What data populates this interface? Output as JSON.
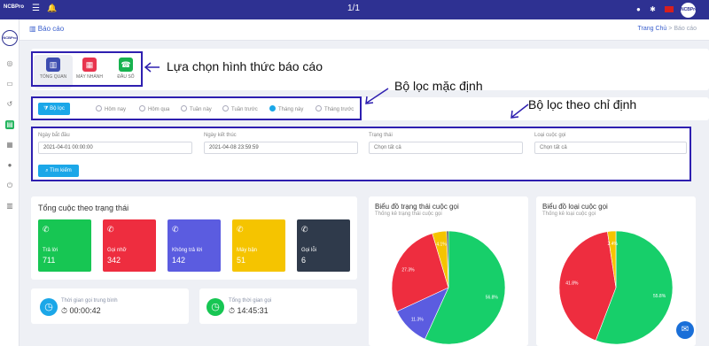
{
  "topbar": {
    "logo": "NCBPro",
    "menu_icon": "menu-icon",
    "page_indicator": "1/1",
    "avatar_text": "NCBPro"
  },
  "header": {
    "title": "Báo cáo",
    "breadcrumb_home": "Trang Chủ",
    "breadcrumb_sep": " > ",
    "breadcrumb_current": "Báo cáo"
  },
  "report_types": [
    {
      "label": "TỔNG QUAN",
      "icon": "building-icon",
      "color": "#3d4db0"
    },
    {
      "label": "MÁY NHÁNH",
      "icon": "calculator-icon",
      "color": "#e8344e"
    },
    {
      "label": "ĐẦU SỐ",
      "icon": "phone-icon",
      "color": "#17b24f"
    }
  ],
  "annotations": {
    "report_type": "Lựa chọn hình thức báo cáo",
    "default_filter": "Bộ lọc mặc định",
    "custom_filter": "Bộ lọc theo chỉ định"
  },
  "filter": {
    "button_label": "Bộ lọc",
    "options": [
      "Hôm nay",
      "Hôm qua",
      "Tuần này",
      "Tuần trước",
      "Tháng này",
      "Tháng trước"
    ],
    "selected": "Tháng này"
  },
  "custom": {
    "start_label": "Ngày bắt đầu",
    "start_value": "2021-04-01 00:00:00",
    "end_label": "Ngày kết thúc",
    "end_value": "2021-04-08 23:59:59",
    "status_label": "Trạng thái",
    "status_value": "Chọn tất cả",
    "type_label": "Loại cuộc gọi",
    "type_value": "Chọn tất cả",
    "search_label": "Tìm kiếm"
  },
  "status_summary": {
    "title": "Tổng cuộc theo trạng thái",
    "cards": [
      {
        "label": "Trả lời",
        "value": "711",
        "color": "#17c653",
        "icon": "phone-icon"
      },
      {
        "label": "Gọi nhỡ",
        "value": "342",
        "color": "#ee2d3f",
        "icon": "missed-call-icon"
      },
      {
        "label": "Không trả lời",
        "value": "142",
        "color": "#5b5ce0",
        "icon": "phone-icon"
      },
      {
        "label": "Máy bận",
        "value": "51",
        "color": "#f5c400",
        "icon": "phone-busy-icon"
      },
      {
        "label": "Gọi lỗi",
        "value": "6",
        "color": "#2f3a4b",
        "icon": "phone-error-icon"
      }
    ]
  },
  "times": {
    "avg_label": "Thời gian gọi trung bình",
    "avg_value": "00:00:42",
    "total_label": "Tổng thời gian gọi",
    "total_value": "14:45:31",
    "clock_glyph": "⏱"
  },
  "chart_data": [
    {
      "type": "pie",
      "title": "Biểu đồ trạng thái cuộc gọi",
      "subtitle": "Thống kê trạng thái cuộc gọi",
      "slices": [
        {
          "value": 56.8,
          "label": "56.8%",
          "color": "#17cf6a"
        },
        {
          "value": 11.3,
          "label": "11.3%",
          "color": "#5b5ce0"
        },
        {
          "value": 27.3,
          "label": "27.3%",
          "color": "#ee2d3f"
        },
        {
          "value": 4.1,
          "label": "4.1%",
          "color": "#f5c400"
        },
        {
          "value": 0.5,
          "label": "",
          "color": "#2f3a4b"
        }
      ]
    },
    {
      "type": "pie",
      "title": "Biểu đồ loại cuộc gọi",
      "subtitle": "Thống kê loại cuộc gọi",
      "slices": [
        {
          "value": 55.8,
          "label": "55.8%",
          "color": "#17cf6a"
        },
        {
          "value": 41.8,
          "label": "41.8%",
          "color": "#ee2d3f"
        },
        {
          "value": 2.4,
          "label": "2.4%",
          "color": "#f5c400"
        }
      ]
    }
  ]
}
